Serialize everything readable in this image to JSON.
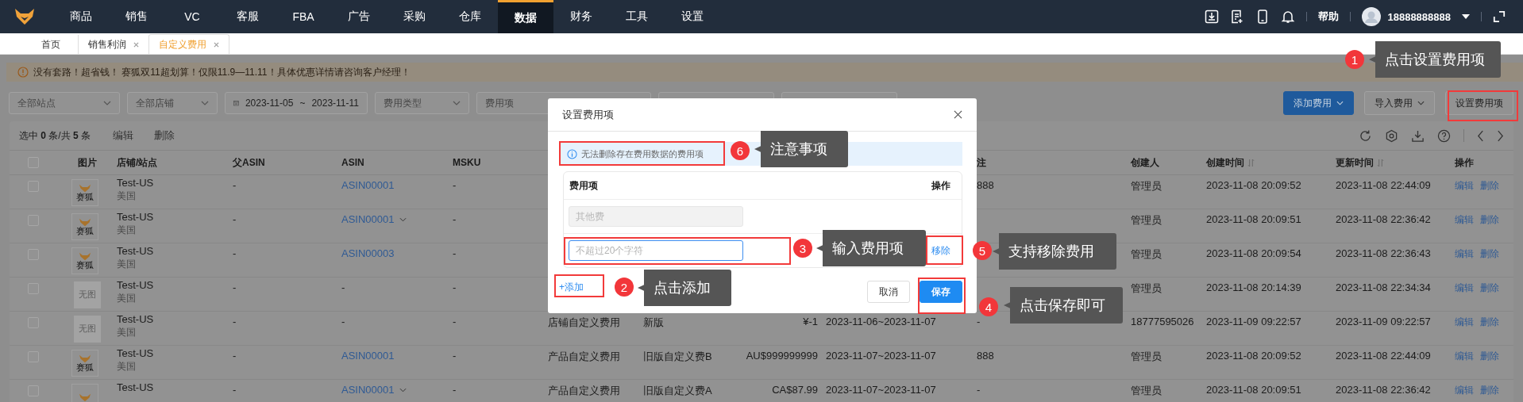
{
  "top_nav": {
    "items": [
      {
        "label": "商品",
        "selected": false
      },
      {
        "label": "销售",
        "selected": false
      },
      {
        "label": "VC",
        "selected": false
      },
      {
        "label": "客服",
        "selected": false
      },
      {
        "label": "FBA",
        "selected": false
      },
      {
        "label": "广告",
        "selected": false
      },
      {
        "label": "采购",
        "selected": false
      },
      {
        "label": "仓库",
        "selected": false
      },
      {
        "label": "数据",
        "selected": true
      },
      {
        "label": "财务",
        "selected": false
      },
      {
        "label": "工具",
        "selected": false
      },
      {
        "label": "设置",
        "selected": false
      }
    ],
    "help": "帮助",
    "account": "18888888888"
  },
  "tabs": [
    {
      "label": "首页",
      "selected": false,
      "closable": false
    },
    {
      "label": "销售利润",
      "selected": false,
      "closable": true
    },
    {
      "label": "自定义费用",
      "selected": true,
      "closable": true
    }
  ],
  "notice": "没有套路！超省钱！ 赛狐双11超划算！仅限11.9—11.11！具体优惠详情请咨询客户经理！",
  "filters": [
    {
      "kind": "select",
      "placeholder": "全部站点"
    },
    {
      "kind": "select",
      "placeholder": "全部店铺"
    },
    {
      "kind": "date",
      "start": "2023-11-05",
      "separator": "~",
      "end": "2023-11-11"
    },
    {
      "kind": "select",
      "placeholder": "费用类型"
    },
    {
      "kind": "input",
      "placeholder": "费用项"
    },
    {
      "kind": "box"
    },
    {
      "kind": "box"
    }
  ],
  "actions": [
    {
      "label": "添加费用",
      "kind": "primary",
      "dropdown": true
    },
    {
      "label": "导入费用",
      "kind": "default",
      "dropdown": true
    },
    {
      "label": "设置费用项",
      "kind": "default",
      "dropdown": false
    }
  ],
  "toolbar": {
    "selection": "选中 **0** 条/共 **5** 条",
    "buttons": [
      "编辑",
      "删除"
    ]
  },
  "table": {
    "header_checked": false,
    "columns": [
      {
        "label": "图片",
        "sortable": false
      },
      {
        "label": "店铺/站点",
        "sortable": false
      },
      {
        "label": "父ASIN",
        "sortable": false
      },
      {
        "label": "ASIN",
        "sortable": false
      },
      {
        "label": "MSKU",
        "sortable": false
      },
      {},
      {},
      {},
      {},
      {
        "label": "注",
        "sortable": false
      },
      {
        "label": "创建人",
        "sortable": false
      },
      {
        "label": "创建时间",
        "sortable": true
      },
      {
        "label": "更新时间",
        "sortable": true
      },
      {
        "label": "操作",
        "sortable": false
      }
    ],
    "rows": [
      {
        "checked": false,
        "image": {
          "kind": "logo",
          "caption": "赛狐"
        },
        "store": "Test-US",
        "site": "美国",
        "parent_asin": "-",
        "asin": {
          "text": "ASIN00001",
          "link": true,
          "dropdown": false
        },
        "msku": "-",
        "remark": "888",
        "creator": "管理员",
        "created": "2023-11-08 20:09:52",
        "updated": "2023-11-08 22:44:09",
        "actions": [
          "编辑",
          "删除"
        ]
      },
      {
        "checked": false,
        "image": {
          "kind": "logo",
          "caption": "赛狐"
        },
        "store": "Test-US",
        "site": "美国",
        "parent_asin": "-",
        "asin": {
          "text": "ASIN00001",
          "link": true,
          "dropdown": true
        },
        "msku": "-",
        "creator": "管理员",
        "created": "2023-11-08 20:09:51",
        "updated": "2023-11-08 22:36:42",
        "actions": [
          "编辑",
          "删除"
        ]
      },
      {
        "checked": false,
        "image": {
          "kind": "logo",
          "caption": "赛狐"
        },
        "store": "Test-US",
        "site": "美国",
        "parent_asin": "-",
        "asin": {
          "text": "ASIN00003",
          "link": true,
          "dropdown": false
        },
        "msku": "-",
        "creator": "管理员",
        "created": "2023-11-08 20:09:54",
        "updated": "2023-11-08 22:36:43",
        "actions": [
          "编辑",
          "删除"
        ]
      },
      {
        "checked": false,
        "image": {
          "kind": "none",
          "caption": "无图"
        },
        "store": "Test-US",
        "site": "美国",
        "parent_asin": "-",
        "asin": {
          "text": "-",
          "link": false,
          "dropdown": false
        },
        "msku": "-",
        "creator": "管理员",
        "created": "2023-11-08 20:14:39",
        "updated": "2023-11-08 22:34:34",
        "actions": [
          "编辑",
          "删除"
        ]
      },
      {
        "checked": false,
        "image": {
          "kind": "none",
          "caption": "无图"
        },
        "store": "Test-US",
        "site": "美国",
        "parent_asin": "-",
        "asin": {
          "text": "-",
          "link": false,
          "dropdown": false
        },
        "msku": "-",
        "fee_type": "店铺自定义费用",
        "fee_item": "新版",
        "amount": "¥-1",
        "period": "2023-11-06~2023-11-07",
        "remark": "-",
        "creator": "18777595026",
        "created": "2023-11-09 09:22:57",
        "updated": "2023-11-09 09:22:57",
        "actions": [
          "编辑",
          "删除"
        ]
      },
      {
        "checked": false,
        "image": {
          "kind": "logo",
          "caption": "赛狐"
        },
        "store": "Test-US",
        "site": "美国",
        "parent_asin": "-",
        "asin": {
          "text": "ASIN00001",
          "link": true,
          "dropdown": false
        },
        "msku": "-",
        "fee_type": "产品自定义费用",
        "fee_item": "旧版自定义费B",
        "amount": "AU$999999999",
        "period": "2023-11-07~2023-11-07",
        "remark": "888",
        "creator": "管理员",
        "created": "2023-11-08 20:09:52",
        "updated": "2023-11-08 22:44:09",
        "actions": [
          "编辑",
          "删除"
        ]
      },
      {
        "checked": false,
        "image": {
          "kind": "logo"
        },
        "store": "Test-US",
        "parent_asin": "-",
        "asin": {
          "text": "ASIN00001",
          "link": true,
          "dropdown": true
        },
        "msku": "-",
        "fee_type": "产品自定义费用",
        "fee_item": "旧版自定义费A",
        "amount": "CA$87.99",
        "period": "2023-11-07~2023-11-07",
        "remark": "-",
        "creator": "管理员",
        "created": "2023-11-08 20:09:51",
        "updated": "2023-11-08 22:36:42",
        "actions": [
          "编辑",
          "删除"
        ]
      }
    ]
  },
  "modal": {
    "title": "设置费用项",
    "notice": "无法删除存在费用数据的费用项",
    "columns": [
      "费用项",
      "操作"
    ],
    "items": [
      {
        "kind": "fixed",
        "value": "其他费",
        "disabled": true
      },
      {
        "kind": "new",
        "placeholder": "不超过20个字符",
        "disabled": false,
        "action": "移除"
      }
    ],
    "add": "+添加",
    "buttons": [
      {
        "label": "取消",
        "kind": "default"
      },
      {
        "label": "保存",
        "kind": "primary"
      }
    ]
  },
  "callouts": [
    {
      "number": "1",
      "text": "点击设置费用项"
    },
    {
      "number": "6",
      "text": "注意事项"
    },
    {
      "number": "3",
      "text": "输入费用项"
    },
    {
      "number": "5",
      "text": "支持移除费用"
    },
    {
      "number": "2",
      "text": "点击添加"
    },
    {
      "number": "4",
      "text": "点击保存即可"
    }
  ]
}
